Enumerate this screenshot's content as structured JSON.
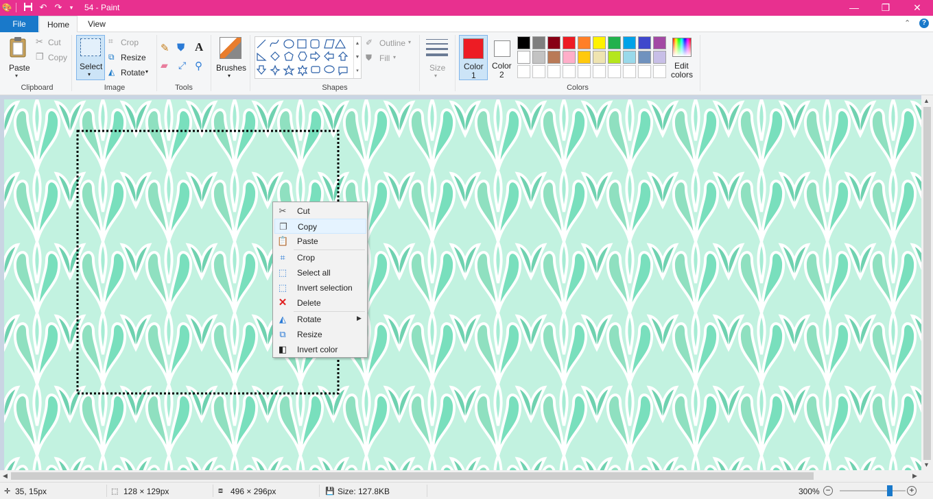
{
  "window": {
    "title": "54 - Paint",
    "quick_access": [
      "paint-app-icon",
      "save-icon",
      "undo-icon",
      "redo-icon",
      "customize-icon"
    ]
  },
  "menu": {
    "file": "File",
    "home": "Home",
    "view": "View",
    "help_icon": "help-icon"
  },
  "ribbon": {
    "clipboard": {
      "label": "Clipboard",
      "paste": "Paste",
      "cut": "Cut",
      "copy": "Copy"
    },
    "image": {
      "label": "Image",
      "select": "Select",
      "crop": "Crop",
      "resize": "Resize",
      "rotate": "Rotate"
    },
    "tools": {
      "label": "Tools"
    },
    "brushes": {
      "label": "Brushes"
    },
    "shapes": {
      "label": "Shapes",
      "outline": "Outline",
      "fill": "Fill"
    },
    "size": {
      "label": "Size"
    },
    "colors": {
      "label": "Colors",
      "color1_line1": "Color",
      "color1_line2": "1",
      "color2_line1": "Color",
      "color2_line2": "2",
      "edit_line1": "Edit",
      "edit_line2": "colors",
      "color1": "#ed1c24",
      "color2": "#ffffff",
      "palette_row1": [
        "#000000",
        "#7f7f7f",
        "#880015",
        "#ed1c24",
        "#ff7f27",
        "#fff200",
        "#22b14c",
        "#00a2e8",
        "#3f48cc",
        "#a349a4"
      ],
      "palette_row2": [
        "#ffffff",
        "#c3c3c3",
        "#b97a57",
        "#ffaec9",
        "#ffc90e",
        "#efe4b0",
        "#b5e61d",
        "#99d9ea",
        "#7092be",
        "#c8bfe7"
      ]
    }
  },
  "context_menu": {
    "items": [
      {
        "label": "Cut",
        "icon": "scissors-icon"
      },
      {
        "label": "Copy",
        "icon": "copy-icon"
      },
      {
        "label": "Paste",
        "icon": "paste-icon"
      },
      {
        "label": "Crop",
        "icon": "crop-icon"
      },
      {
        "label": "Select all",
        "icon": "select-all-icon"
      },
      {
        "label": "Invert selection",
        "icon": "invert-selection-icon"
      },
      {
        "label": "Delete",
        "icon": "delete-icon"
      },
      {
        "label": "Rotate",
        "icon": "rotate-icon"
      },
      {
        "label": "Resize",
        "icon": "resize-icon"
      },
      {
        "label": "Invert color",
        "icon": "invert-color-icon"
      }
    ]
  },
  "status": {
    "cursor": "35, 15px",
    "selection": "128 × 129px",
    "image_size": "496 × 296px",
    "file_size": "Size: 127.8KB",
    "zoom": "300%",
    "zoom_level_percent": 300
  }
}
